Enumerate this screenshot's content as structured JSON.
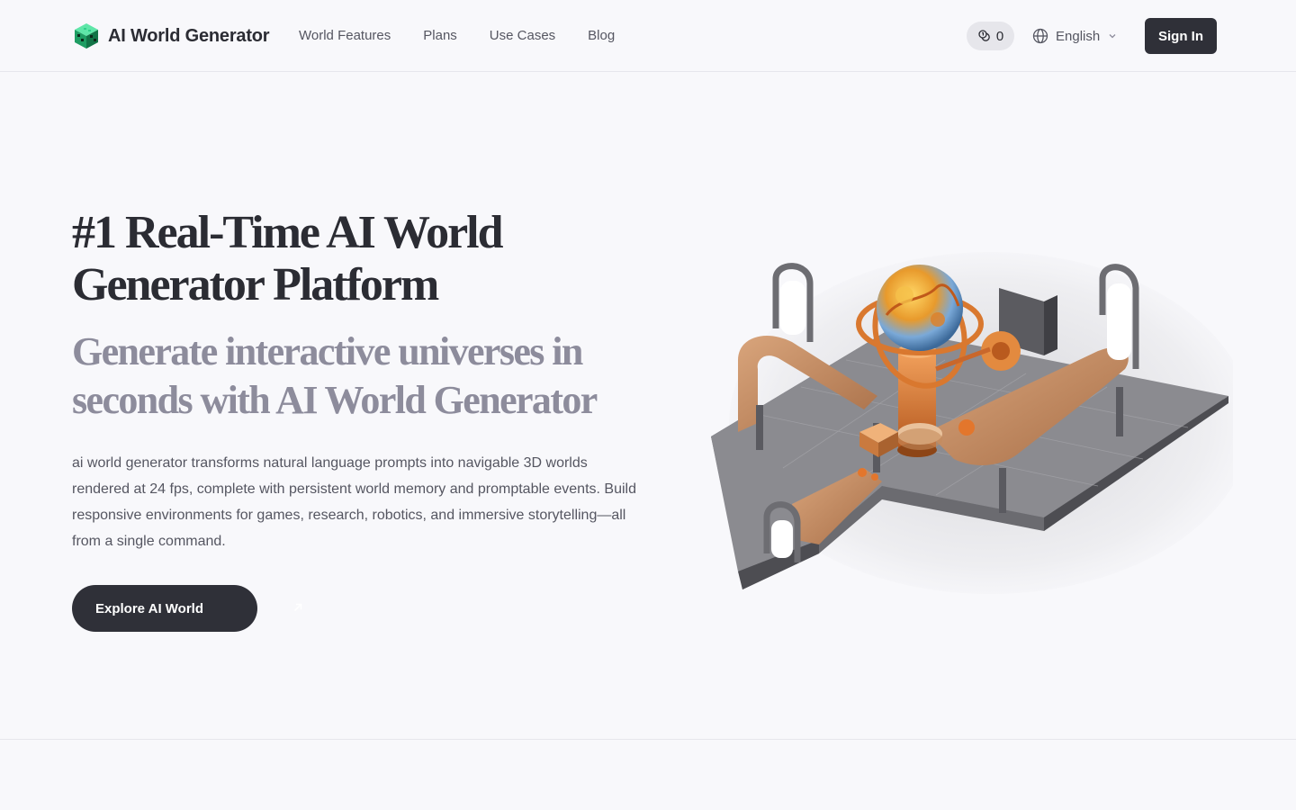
{
  "header": {
    "logo_text": "AI World Generator",
    "nav": [
      {
        "label": "World Features"
      },
      {
        "label": "Plans"
      },
      {
        "label": "Use Cases"
      },
      {
        "label": "Blog"
      }
    ],
    "credits_count": "0",
    "language": "English",
    "signin_label": "Sign In"
  },
  "hero": {
    "title": "#1 Real-Time AI World Generator Platform",
    "subtitle": "Generate interactive universes in seconds with AI World Generator",
    "body": "ai world generator transforms natural language prompts into navigable 3D worlds rendered at 24 fps, complete with persistent world memory and promptable events. Build responsive environments for games, research, robotics, and immersive storytelling—all from a single command.",
    "cta_label": "Explore AI World"
  },
  "colors": {
    "background": "#f8f8fb",
    "dark": "#2f3038",
    "muted_heading": "#8d8c9c",
    "brand_green": "#2fd08a"
  },
  "icons": {
    "logo": "green-cube-logo-icon",
    "credits": "coins-icon",
    "language": "globe-icon",
    "language_caret": "chevron-down-icon",
    "cta": "arrow-up-right-icon"
  }
}
